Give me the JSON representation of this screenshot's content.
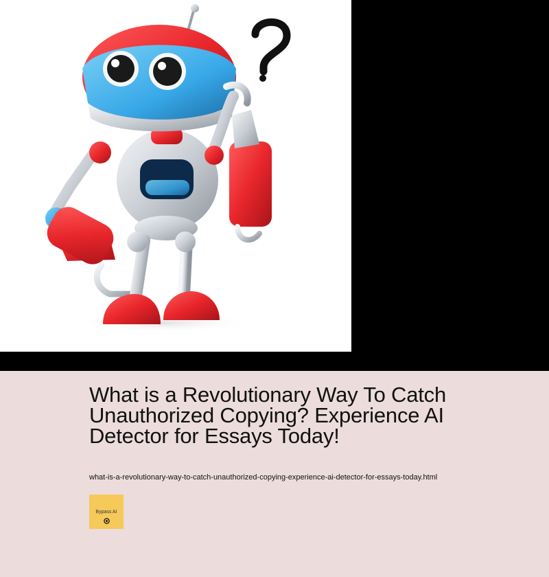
{
  "article": {
    "title": "What is a Revolutionary Way To Catch Unauthorized Copying? Experience AI Detector for Essays Today!",
    "filename": "what-is-a-revolutionary-way-to-catch-unauthorized-copying-experience-ai-detector-for-essays-today.html"
  },
  "hero": {
    "image_subject": "robot-question-mark-illustration"
  },
  "logo": {
    "label": "Bypass AI",
    "icon": "target-icon",
    "background": "#f5c95a"
  },
  "colors": {
    "page_background": "#000000",
    "content_background": "#ecdcdc",
    "robot_red": "#e8262b",
    "robot_blue": "#38a8e8",
    "robot_silver": "#d9dde2"
  }
}
